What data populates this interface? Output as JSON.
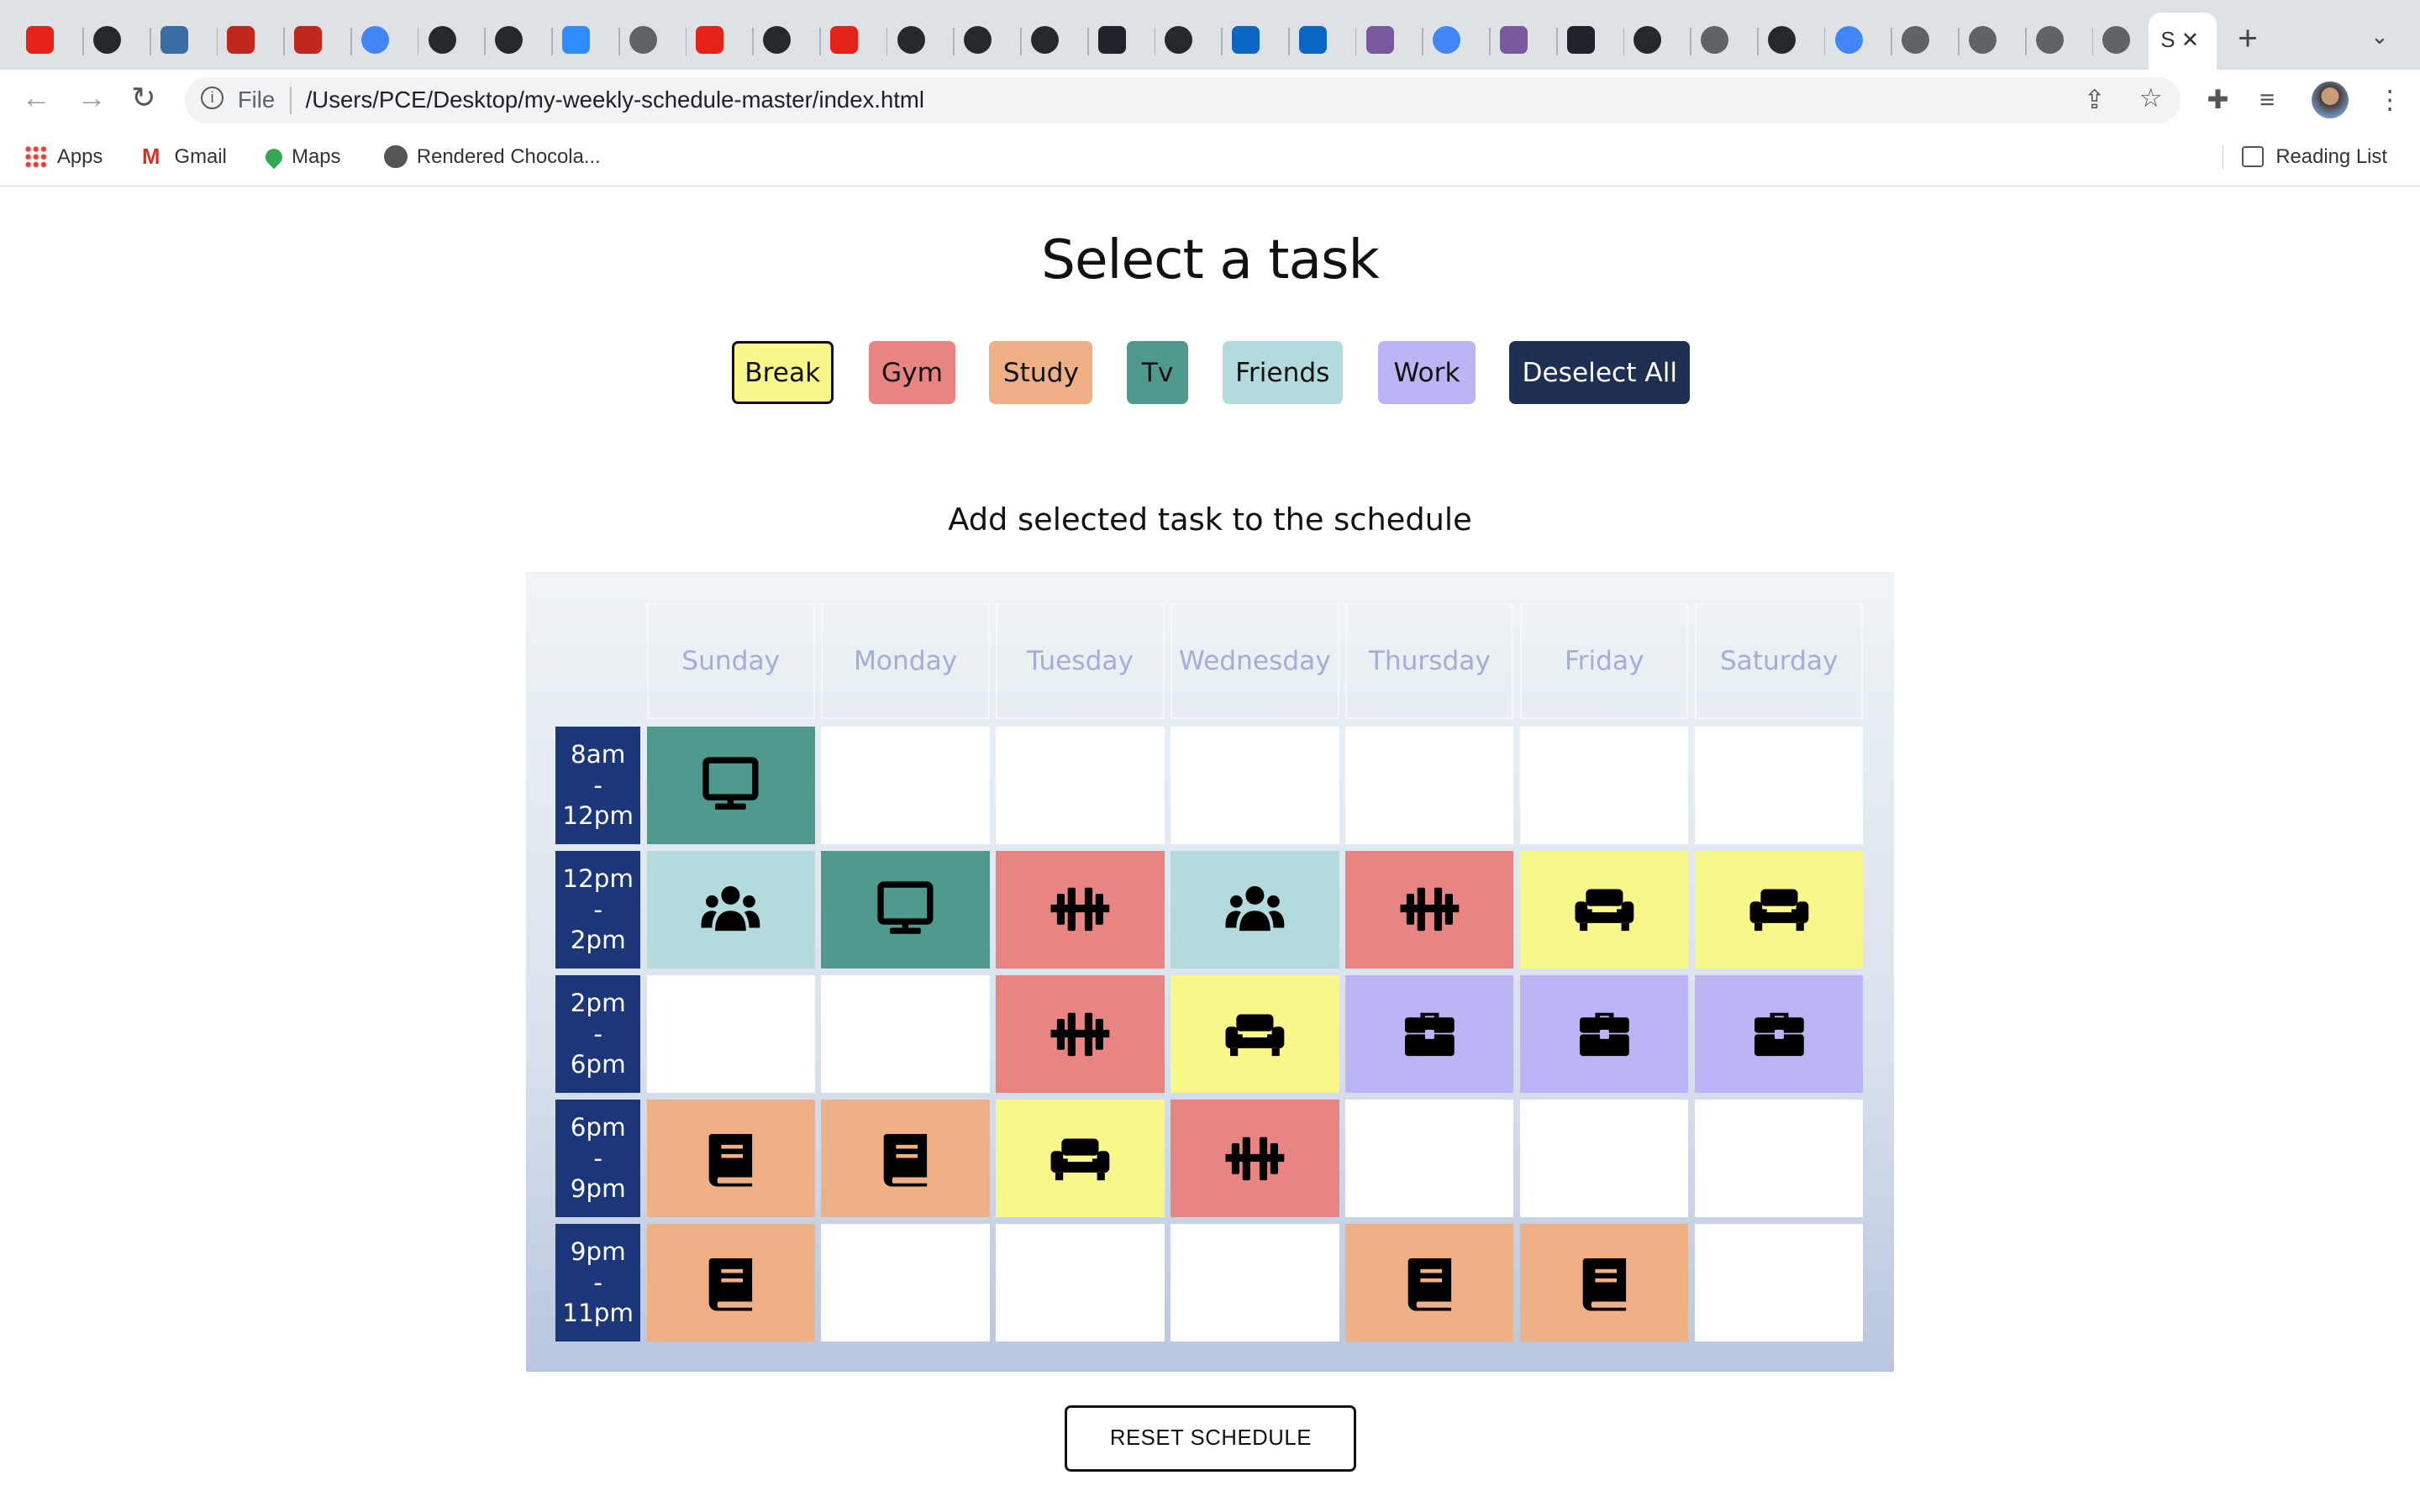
{
  "browser": {
    "tab_favicons": [
      "youtube",
      "github",
      "ucla",
      "news",
      "news",
      "google",
      "github",
      "github",
      "zoom",
      "globe",
      "youtube",
      "github",
      "youtube",
      "github",
      "github",
      "github",
      "react",
      "github",
      "linkedin",
      "linkedin",
      "heroku",
      "google",
      "heroku",
      "react",
      "github",
      "globe",
      "github",
      "google",
      "globe",
      "globe",
      "globe",
      "globe"
    ],
    "active_tab_label": "S",
    "url_scheme_label": "File",
    "url": "/Users/PCE/Desktop/my-weekly-schedule-master/index.html",
    "bookmarks": [
      {
        "label": "Apps",
        "icon": "apps-grid-icon"
      },
      {
        "label": "Gmail",
        "icon": "gmail-icon"
      },
      {
        "label": "Maps",
        "icon": "maps-icon"
      },
      {
        "label": "Rendered Chocola...",
        "icon": "globe-icon"
      }
    ],
    "reading_list": "Reading List"
  },
  "page": {
    "title": "Select a task",
    "tasks": [
      {
        "key": "break",
        "label": "Break",
        "color": "#f7f78a",
        "selected": true
      },
      {
        "key": "gym",
        "label": "Gym",
        "color": "#e88582"
      },
      {
        "key": "study",
        "label": "Study",
        "color": "#f0b085"
      },
      {
        "key": "tv",
        "label": "Tv",
        "color": "#4f9a8d"
      },
      {
        "key": "friends",
        "label": "Friends",
        "color": "#b3dadc"
      },
      {
        "key": "work",
        "label": "Work",
        "color": "#bbb5f5"
      }
    ],
    "deselect_label": "Deselect All",
    "deselect_color": "#1f2f52",
    "subtitle": "Add selected task to the schedule",
    "days": [
      "Sunday",
      "Monday",
      "Tuesday",
      "Wednesday",
      "Thursday",
      "Friday",
      "Saturday"
    ],
    "times": [
      {
        "from": "8am",
        "to": "12pm"
      },
      {
        "from": "12pm",
        "to": "2pm"
      },
      {
        "from": "2pm",
        "to": "6pm"
      },
      {
        "from": "6pm",
        "to": "9pm"
      },
      {
        "from": "9pm",
        "to": "11pm"
      }
    ],
    "schedule": [
      [
        "tv",
        null,
        null,
        null,
        null,
        null,
        null
      ],
      [
        "friends",
        "tv",
        "gym",
        "friends",
        "gym",
        "break",
        "break"
      ],
      [
        null,
        null,
        "gym",
        "break",
        "work",
        "work",
        "work"
      ],
      [
        "study",
        "study",
        "break",
        "gym",
        null,
        null,
        null
      ],
      [
        "study",
        null,
        null,
        null,
        "study",
        "study",
        null
      ]
    ],
    "reset_label": "RESET SCHEDULE"
  }
}
